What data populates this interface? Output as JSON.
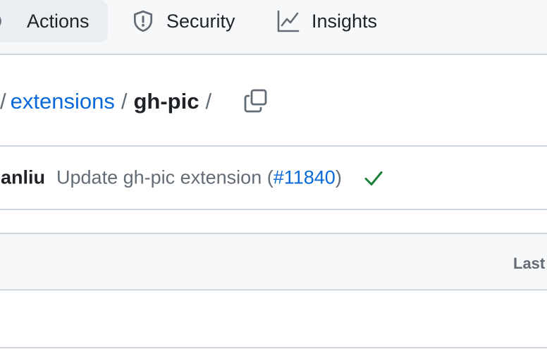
{
  "nav": {
    "tabs": [
      {
        "label": "Actions",
        "icon": "play-circle-icon",
        "selected": true
      },
      {
        "label": "Security",
        "icon": "shield-icon"
      },
      {
        "label": "Insights",
        "icon": "graph-icon"
      }
    ]
  },
  "breadcrumb": {
    "lead_separator": "/",
    "parent": "extensions",
    "separator": "/",
    "current": "gh-pic",
    "trailing_separator": "/",
    "copy_icon": "copy-icon"
  },
  "commit": {
    "author": "sanliu",
    "message_prefix": "Update gh-pic extension (",
    "pr_link": "#11840",
    "message_suffix": ")",
    "status_icon": "check-icon",
    "status_color": "#1a7f37"
  },
  "table": {
    "header_last_col": "Last"
  },
  "colors": {
    "link": "#0969da",
    "muted": "#636c76",
    "border": "#d0d7de",
    "nav_bg": "#f6f8fa"
  }
}
